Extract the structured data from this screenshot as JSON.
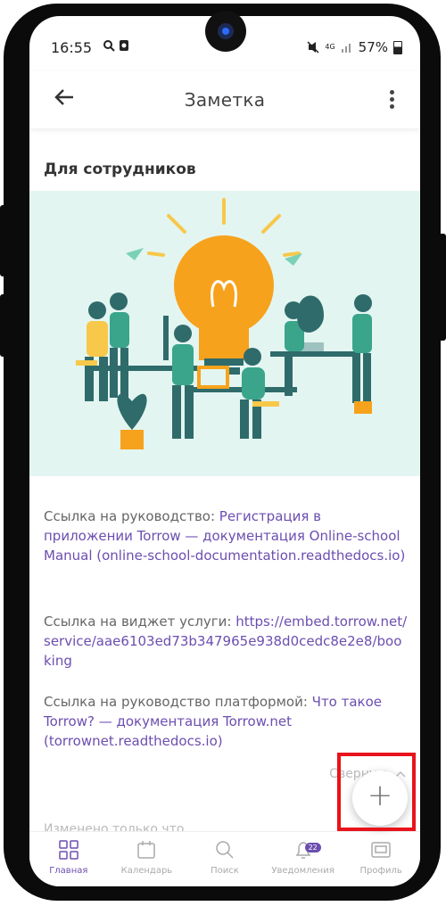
{
  "status": {
    "time": "16:55",
    "network": "4G",
    "battery": "57%"
  },
  "appbar": {
    "title": "Заметка"
  },
  "note": {
    "heading": "Для сотрудников",
    "block1_prefix": "Ссылка на руководство: ",
    "block1_link": "Регистрация в приложении Torrow — документация Online-school Manual (online-school-documentation.readthedocs.io)",
    "block2_prefix": "Ссылка на виджет услуги: ",
    "block2_link": "https://embed.torrow.net/service/aae6103ed73b347965e938d0cedc8e2e8/booking",
    "block3_prefix": "Ссылка на руководство платформой: ",
    "block3_link": "Что такое Torrow? — документация Torrow.net (torrownet.readthedocs.io)",
    "collapse_label": "Свернуть",
    "modified_label": "Изменено только что"
  },
  "bottom_nav": {
    "items": [
      {
        "label": "Главная",
        "icon": "grid-icon"
      },
      {
        "label": "Календарь",
        "icon": "calendar-icon"
      },
      {
        "label": "Поиск",
        "icon": "search-icon"
      },
      {
        "label": "Уведомления",
        "icon": "bell-icon",
        "badge": "22"
      },
      {
        "label": "Профиль",
        "icon": "profile-card-icon"
      }
    ]
  },
  "colors": {
    "accent": "#6c4eb0",
    "highlight": "#e8131b",
    "illustration_bg": "#e3f5f1"
  }
}
